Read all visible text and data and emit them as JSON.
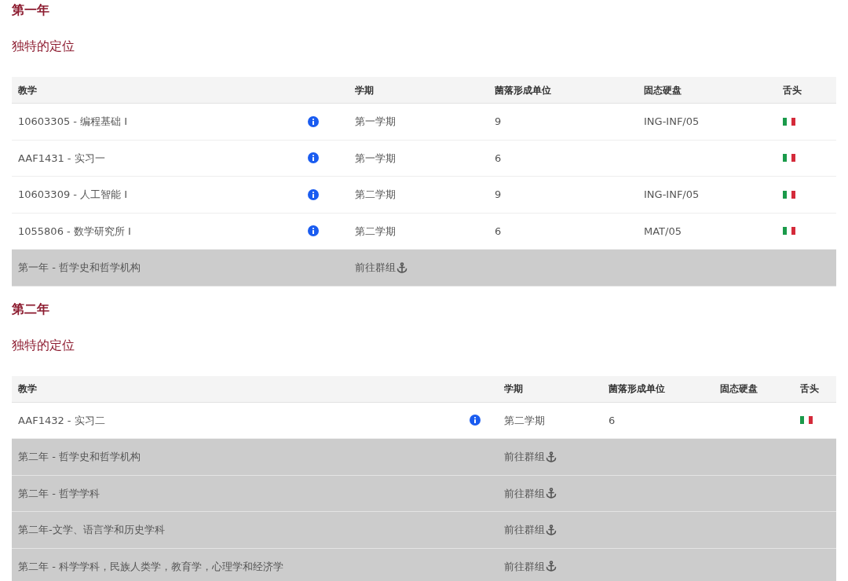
{
  "years": [
    {
      "title": "第一年",
      "subtitle": "独特的定位",
      "table": {
        "columns": [
          "教学",
          "学期",
          "菌落形成单位",
          "固态硬盘",
          "舌头"
        ],
        "rows": [
          {
            "kind": "course",
            "course": "10603305 - 编程基础 I",
            "semester": "第一学期",
            "credits": "9",
            "ssd": "ING-INF/05"
          },
          {
            "kind": "course",
            "course": "AAF1431 - 实习一",
            "semester": "第一学期",
            "credits": "6",
            "ssd": ""
          },
          {
            "kind": "course",
            "course": "10603309 - 人工智能 I",
            "semester": "第二学期",
            "credits": "9",
            "ssd": "ING-INF/05"
          },
          {
            "kind": "course",
            "course": "1055806 - 数学研究所 I",
            "semester": "第二学期",
            "credits": "6",
            "ssd": "MAT/05"
          },
          {
            "kind": "group",
            "course": "第一年 - 哲学史和哲学机构",
            "link": "前往群组"
          }
        ]
      }
    },
    {
      "title": "第二年",
      "subtitle": "独特的定位",
      "table": {
        "columns": [
          "教学",
          "学期",
          "菌落形成单位",
          "固态硬盘",
          "舌头"
        ],
        "rows": [
          {
            "kind": "course",
            "course": "AAF1432 - 实习二",
            "semester": "第二学期",
            "credits": "6",
            "ssd": ""
          },
          {
            "kind": "group",
            "course": "第二年 - 哲学史和哲学机构",
            "link": "前往群组"
          },
          {
            "kind": "group",
            "course": "第二年 - 哲学学科",
            "link": "前往群组"
          },
          {
            "kind": "group",
            "course": "第二年-文学、语言学和历史学科",
            "link": "前往群组"
          },
          {
            "kind": "group",
            "course": "第二年 - 科学学科，民族人类学，教育学，心理学和经济学",
            "link": "前往群组"
          }
        ]
      }
    }
  ]
}
